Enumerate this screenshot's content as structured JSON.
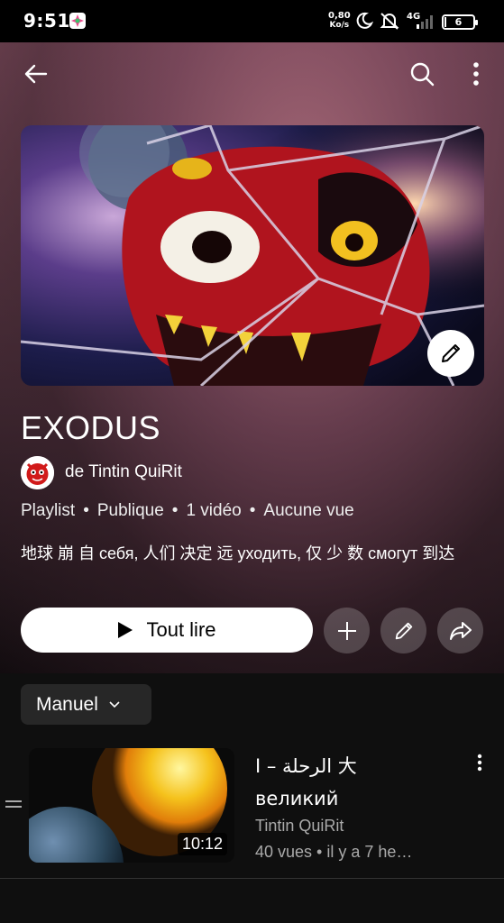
{
  "status_bar": {
    "time": "9:51",
    "net_speed_value": "0,80",
    "net_speed_unit": "Ko/s",
    "network_type": "4G",
    "battery": "6"
  },
  "topbar": {
    "back_icon": "arrow-left-icon",
    "search_icon": "search-icon",
    "more_icon": "more-vert-icon"
  },
  "playlist": {
    "title": "EXODUS",
    "owner": "de Tintin QuiRit",
    "meta": [
      "Playlist",
      "Publique",
      "1 vidéo",
      "Aucune vue"
    ],
    "meta_separator": "•",
    "description": "地球 崩 自 себя, 人们 决定 远 уходить, 仅 少 数 смогут 到达"
  },
  "actions": {
    "play_all_label": "Tout lire",
    "add_icon": "plus-icon",
    "edit_icon": "pencil-icon",
    "share_icon": "share-icon"
  },
  "sort": {
    "selected": "Manuel"
  },
  "videos": [
    {
      "title_line1": "I – الرحلة 大",
      "title_line2": "великий",
      "channel": "Tintin QuiRit",
      "stats": "40 vues  •  il y a 7 he…",
      "duration": "10:12"
    }
  ],
  "colors": {
    "header_gradient_top": "#7a4a5a",
    "list_background": "#0f0f0f",
    "chip_background": "#272727",
    "secondary_text": "#aaaaaa"
  }
}
